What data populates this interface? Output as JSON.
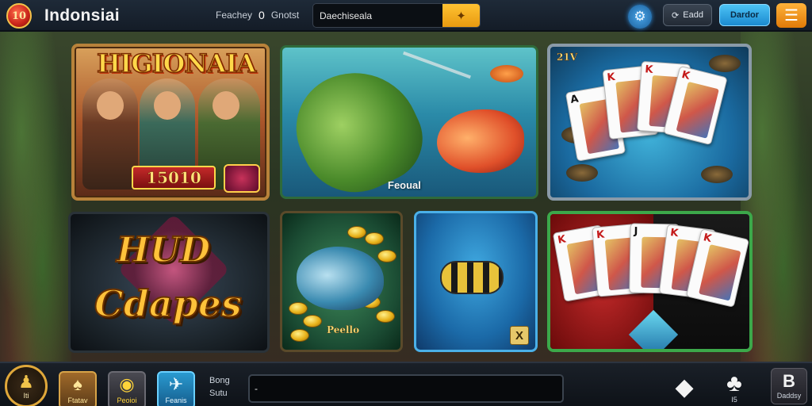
{
  "header": {
    "logo_text": "10",
    "title": "Indonsiai",
    "nav": {
      "item1": "Feachey",
      "item2": "0",
      "item3": "Gnotst"
    },
    "search": {
      "value": "Daechiseala"
    },
    "buttons": {
      "login": "Eadd",
      "register": "Dardor"
    }
  },
  "games": [
    {
      "title": "HIGIONAIA",
      "score": "15010"
    },
    {
      "label": "Feoual"
    },
    {
      "badge": "21V"
    },
    {
      "line1": "HUD",
      "line2": "Cdapes"
    },
    {
      "label": "Peello"
    },
    {
      "close": "X"
    },
    {
      "cards": [
        {
          "rank": "K",
          "color": "#c41a1a"
        },
        {
          "rank": "K",
          "color": "#c41a1a"
        },
        {
          "rank": "J",
          "color": "#111111"
        },
        {
          "rank": "K",
          "color": "#c41a1a"
        },
        {
          "rank": "K",
          "color": "#c41a1a"
        }
      ]
    }
  ],
  "under_cards": [
    {
      "rank": "A",
      "color": "#111111"
    },
    {
      "rank": "K",
      "color": "#c41a1a"
    },
    {
      "rank": "K",
      "color": "#c41a1a"
    },
    {
      "rank": "K",
      "color": "#c41a1a"
    }
  ],
  "footer": {
    "profile_label": "Iti",
    "dock": [
      {
        "label": "Ftatav",
        "icon": "gift-icon"
      },
      {
        "label": "Peoioi",
        "icon": "coin-icon"
      },
      {
        "label": "Feanis",
        "icon": "bird-icon"
      }
    ],
    "chat_label_line1": "Bong",
    "chat_label_line2": "Sutu",
    "chat_input_value": "-",
    "club_label": "I5",
    "cash_label": "Daddsy"
  },
  "colors": {
    "accent": "#ffc232",
    "brand": "#1b8ad0",
    "gold": "#e0a83a"
  }
}
